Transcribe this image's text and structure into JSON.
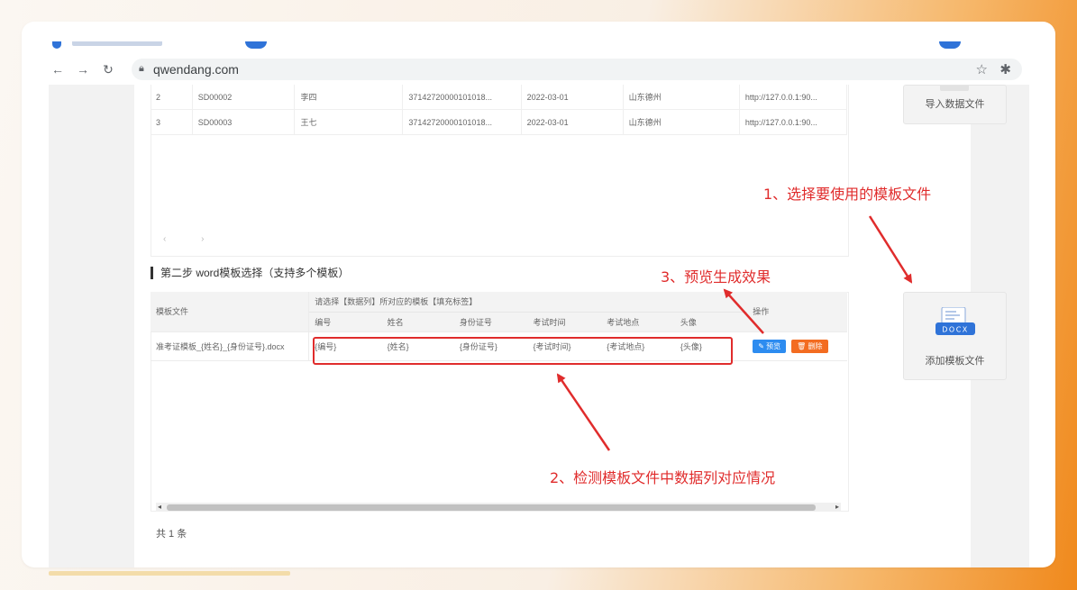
{
  "browser": {
    "url": "qwendang.com",
    "icons": [
      "back-icon",
      "forward-icon",
      "reload-icon",
      "lock-icon",
      "star-icon",
      "extensions-icon"
    ]
  },
  "data_table": {
    "rows": [
      [
        "2",
        "SD00002",
        "李四",
        "37142720000101018...",
        "2022-03-01",
        "山东德州",
        "http://127.0.0.1:90..."
      ],
      [
        "3",
        "SD00003",
        "王七",
        "37142720000101018...",
        "2022-03-01",
        "山东德州",
        "http://127.0.0.1:90..."
      ]
    ]
  },
  "import_button": {
    "label": "导入数据文件"
  },
  "add_template_button": {
    "label": "添加模板文件",
    "icon_text": "DOCX"
  },
  "section": {
    "title": "第二步 word模板选择（支持多个模板）"
  },
  "template_table": {
    "col_template": "模板文件",
    "group_header": "请选择【数据列】所对应的模板【填充标签】",
    "col_actions": "操作",
    "sub_headers": [
      "编号",
      "姓名",
      "身份证号",
      "考试时间",
      "考试地点",
      "头像"
    ],
    "row": {
      "file": "准考证模板_{姓名}_{身份证号}.docx",
      "tags": [
        "{编号}",
        "{姓名}",
        "{身份证号}",
        "{考试时间}",
        "{考试地点}",
        "{头像}"
      ],
      "preview_label": "✎ 预览",
      "delete_label": "🗑 删除"
    }
  },
  "footer": {
    "total": "共 1 条"
  },
  "annotations": {
    "step1": "1、选择要使用的模板文件",
    "step2": "2、检测模板文件中数据列对应情况",
    "step3": "3、预览生成效果"
  },
  "colors": {
    "annotation_red": "#e02c2c",
    "preview_blue": "#2d8cf0",
    "delete_orange": "#f36c21",
    "docx_blue": "#2f73d8"
  }
}
